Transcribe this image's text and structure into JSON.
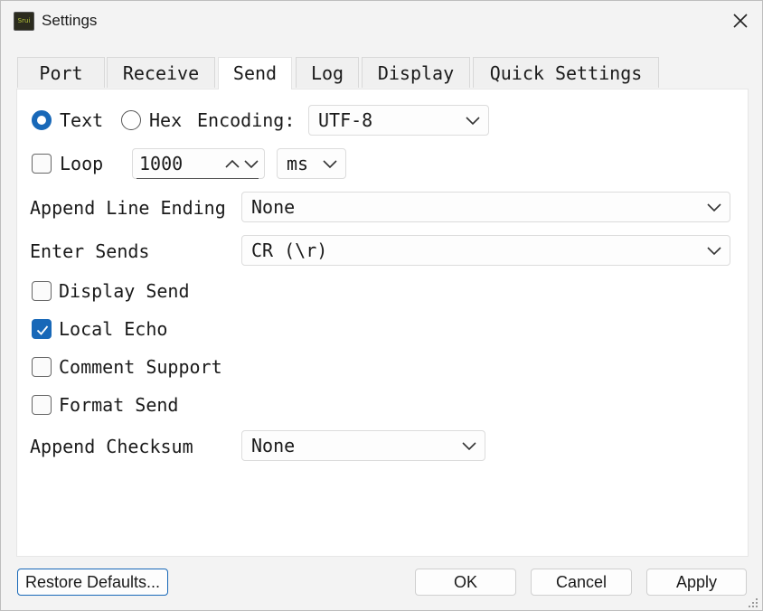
{
  "window": {
    "title": "Settings",
    "icon_label": "Srui",
    "close_icon": "close-icon"
  },
  "tabs": [
    {
      "label": "Port",
      "active": false
    },
    {
      "label": "Receive",
      "active": false
    },
    {
      "label": "Send",
      "active": true
    },
    {
      "label": "Log",
      "active": false
    },
    {
      "label": "Display",
      "active": false
    },
    {
      "label": "Quick Settings",
      "active": false
    }
  ],
  "send": {
    "mode": {
      "text_label": "Text",
      "hex_label": "Hex",
      "selected": "Text"
    },
    "encoding": {
      "label": "Encoding:",
      "value": "UTF-8"
    },
    "loop": {
      "label": "Loop",
      "checked": false,
      "interval": "1000",
      "unit": "ms"
    },
    "line_ending": {
      "label": "Append Line Ending",
      "value": "None"
    },
    "enter_sends": {
      "label": "Enter Sends",
      "value": "CR (\\r)"
    },
    "options": [
      {
        "label": "Display Send",
        "checked": false
      },
      {
        "label": "Local Echo",
        "checked": true
      },
      {
        "label": "Comment Support",
        "checked": false
      },
      {
        "label": "Format Send",
        "checked": false
      }
    ],
    "checksum": {
      "label": "Append Checksum",
      "value": "None"
    }
  },
  "buttons": {
    "restore": "Restore Defaults...",
    "ok": "OK",
    "cancel": "Cancel",
    "apply": "Apply"
  },
  "colors": {
    "accent": "#1868b8",
    "panel": "#ffffff",
    "window": "#f3f3f3"
  }
}
